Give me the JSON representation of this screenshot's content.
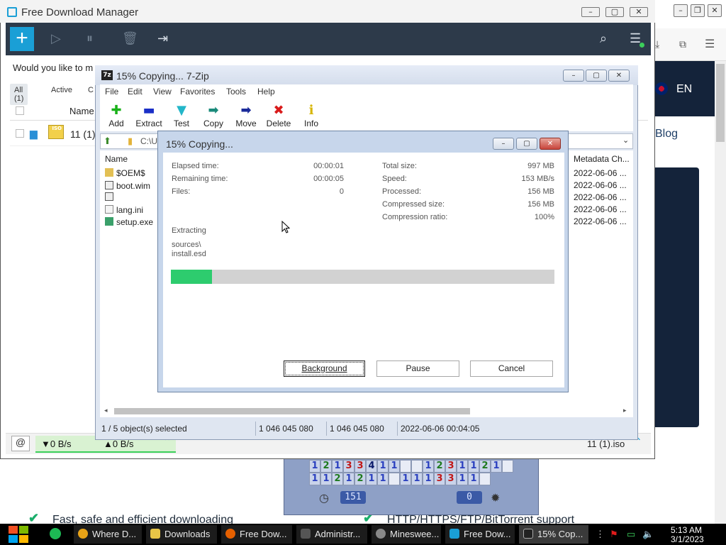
{
  "browser": {
    "language": "EN",
    "blog_link": "Blog",
    "features": [
      "Fast, safe and efficient downloading",
      "HTTP/HTTPS/FTP/BitTorrent support"
    ]
  },
  "minesweeper": {
    "row1": [
      "1",
      "2",
      "1",
      "3",
      "3",
      "4",
      "1",
      "1",
      "",
      "",
      "1",
      "2",
      "3",
      "1",
      "1",
      "2",
      "1"
    ],
    "row2": [
      "",
      "1",
      "1",
      "2",
      "1",
      "2",
      "1",
      "1",
      "",
      "1",
      "1",
      "1",
      "3",
      "3",
      "1",
      "1",
      ""
    ],
    "mine_counter": "151",
    "timer": "0"
  },
  "fdm": {
    "title": "Free Download Manager",
    "add_button": "+",
    "banner": "Would you like to m",
    "filters": [
      "All (1)",
      "Active",
      "C"
    ],
    "col_name": "Name",
    "row_name": "11 (1)",
    "down_speed": "▼0 B/s",
    "up_speed": "▲0 B/s",
    "status_file": "11 (1).iso"
  },
  "zip": {
    "title": "15% Copying... 7-Zip",
    "app_icon": "7z",
    "menu": [
      "File",
      "Edit",
      "View",
      "Favorites",
      "Tools",
      "Help"
    ],
    "tools": [
      {
        "label": "Add",
        "icon": "plus-icon",
        "color": "#19b119"
      },
      {
        "label": "Extract",
        "icon": "minus-icon",
        "color": "#1a2fc7"
      },
      {
        "label": "Test",
        "icon": "check-icon",
        "color": "#23b6c9"
      },
      {
        "label": "Copy",
        "icon": "arrow-right-icon",
        "color": "#1a8a7a"
      },
      {
        "label": "Move",
        "icon": "arrow-right-icon",
        "color": "#1a2a9a"
      },
      {
        "label": "Delete",
        "icon": "x-icon",
        "color": "#d91a1a"
      },
      {
        "label": "Info",
        "icon": "info-icon",
        "color": "#d7b500"
      }
    ],
    "address": "C:\\U",
    "col_name": "Name",
    "col_meta": "Metadata Ch...",
    "files": [
      {
        "name": "$OEM$",
        "type": "folder"
      },
      {
        "name": "boot.wim",
        "type": "file"
      },
      {
        "name": "",
        "type": "file"
      },
      {
        "name": "lang.ini",
        "type": "config"
      },
      {
        "name": "setup.exe",
        "type": "exe"
      }
    ],
    "dates": [
      "2022-06-06 ...",
      "2022-06-06 ...",
      "2022-06-06 ...",
      "2022-06-06 ...",
      "2022-06-06 ..."
    ],
    "status": {
      "selected": "1 / 5 object(s) selected",
      "size1": "1 046 045 080",
      "size2": "1 046 045 080",
      "modified": "2022-06-06 00:04:05"
    }
  },
  "dialog": {
    "title": "15% Copying...",
    "left": {
      "elapsed_label": "Elapsed time:",
      "elapsed": "00:00:01",
      "remaining_label": "Remaining time:",
      "remaining": "00:00:05",
      "files_label": "Files:",
      "files": "0"
    },
    "right": {
      "total_label": "Total size:",
      "total": "997 MB",
      "speed_label": "Speed:",
      "speed": "153 MB/s",
      "processed_label": "Processed:",
      "processed": "156 MB",
      "compressed_label": "Compressed size:",
      "compressed": "156 MB",
      "ratio_label": "Compression ratio:",
      "ratio": "100%"
    },
    "action": "Extracting",
    "path_line1": "sources\\",
    "path_line2": "install.esd",
    "progress": 0.107,
    "buttons": {
      "background": "Background",
      "pause": "Pause",
      "cancel": "Cancel"
    }
  },
  "taskbar": {
    "items": [
      {
        "label": "Where D...",
        "icon": "chrome-icon",
        "color": "#e8a317"
      },
      {
        "label": "Downloads",
        "icon": "folder-icon",
        "color": "#e8c547"
      },
      {
        "label": "Free Dow...",
        "icon": "firefox-icon",
        "color": "#e66000"
      },
      {
        "label": "Administr...",
        "icon": "terminal-icon",
        "color": "#555555"
      },
      {
        "label": "Minesweе...",
        "icon": "mine-icon",
        "color": "#888888"
      },
      {
        "label": "Free Dow...",
        "icon": "fdm-icon",
        "color": "#1a9fd6"
      },
      {
        "label": "15% Cop...",
        "icon": "sevenzip-icon",
        "color": "#222222"
      }
    ],
    "time": "5:13 AM",
    "date": "3/1/2023"
  }
}
